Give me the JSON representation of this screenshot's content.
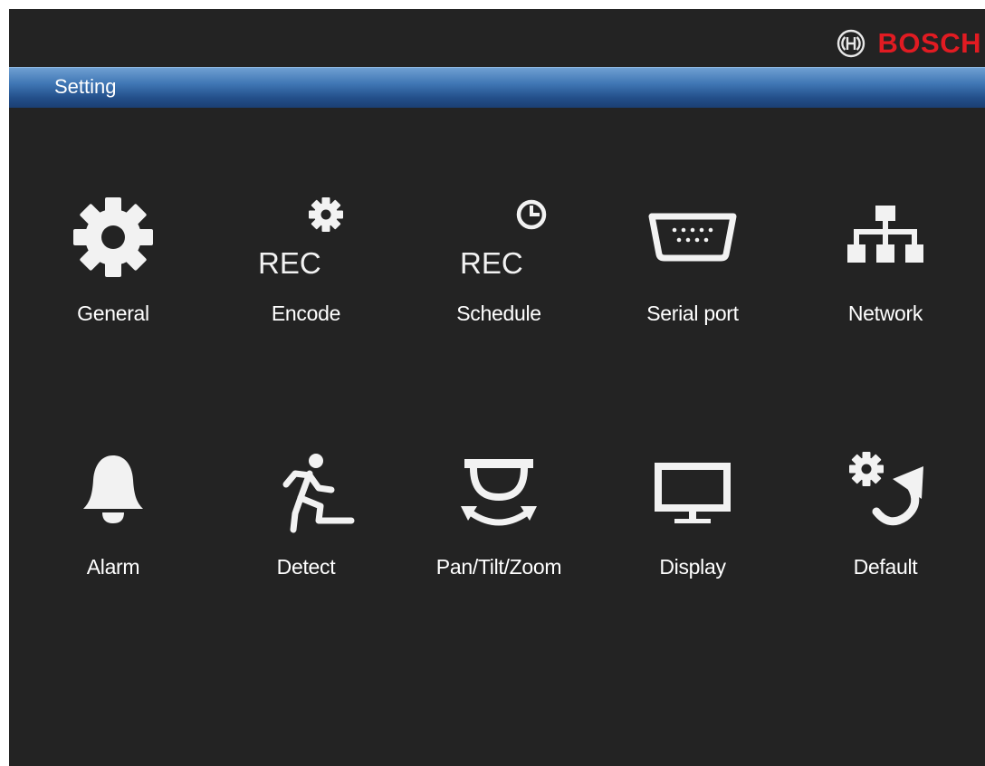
{
  "brand": {
    "name": "BOSCH",
    "color": "#e11b22"
  },
  "window": {
    "title": "Setting"
  },
  "menu": {
    "general": {
      "label": "General",
      "icon": "gear-icon"
    },
    "encode": {
      "label": "Encode",
      "rec_text": "REC",
      "icon": "rec-gear-icon"
    },
    "schedule": {
      "label": "Schedule",
      "rec_text": "REC",
      "icon": "rec-clock-icon"
    },
    "serial_port": {
      "label": "Serial port",
      "icon": "serial-connector-icon"
    },
    "network": {
      "label": "Network",
      "icon": "network-tree-icon"
    },
    "alarm": {
      "label": "Alarm",
      "icon": "bell-icon"
    },
    "detect": {
      "label": "Detect",
      "icon": "running-man-icon"
    },
    "ptz": {
      "label": "Pan/Tilt/Zoom",
      "icon": "ptz-dome-icon"
    },
    "display": {
      "label": "Display",
      "icon": "monitor-icon"
    },
    "default": {
      "label": "Default",
      "icon": "gear-reset-icon"
    }
  },
  "colors": {
    "background": "#232323",
    "titlebar": "#3f76b4",
    "icon": "#f2f2f2",
    "text": "#ffffff"
  }
}
